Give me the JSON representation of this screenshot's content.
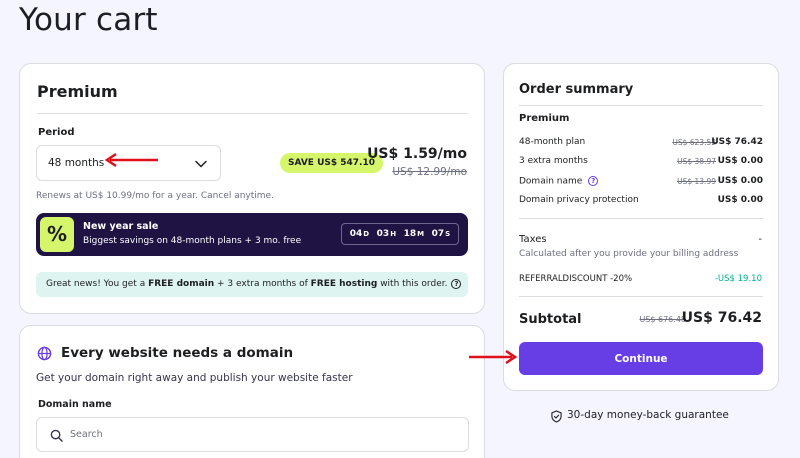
{
  "page": {
    "title": "Your cart"
  },
  "plan": {
    "name": "Premium",
    "period_label": "Period",
    "period_value": "48 months",
    "save_badge": "SAVE US$ 547.10",
    "price": "US$ 1.59/mo",
    "old_price": "US$ 12.99/mo",
    "renews_note": "Renews at US$ 10.99/mo for a year. Cancel anytime.",
    "promo": {
      "icon": "%",
      "title": "New year sale",
      "subtitle": "Biggest savings on 48-month plans + 3 mo. free",
      "countdown": [
        {
          "value": "04",
          "unit": "D"
        },
        {
          "value": "03",
          "unit": "H"
        },
        {
          "value": "18",
          "unit": "M"
        },
        {
          "value": "07",
          "unit": "S"
        }
      ]
    },
    "news": {
      "part1": "Great news! You get a ",
      "bold1": "FREE domain",
      "part2": " + 3 extra months of ",
      "bold2": "FREE hosting",
      "part3": " with this order."
    }
  },
  "domain": {
    "title": "Every website needs a domain",
    "subtitle": "Get your domain right away and publish your website faster",
    "field_label": "Domain name",
    "search_placeholder": "Search"
  },
  "summary": {
    "title": "Order summary",
    "plan": "Premium",
    "rows": [
      {
        "label": "48-month plan",
        "old": "US$ 623.52",
        "value": "US$ 76.42"
      },
      {
        "label": "3 extra months",
        "old": "US$ 38.97",
        "value": "US$ 0.00"
      },
      {
        "label": "Domain name",
        "old": "US$ 13.99",
        "value": "US$ 0.00"
      },
      {
        "label": "Domain privacy protection",
        "old": "",
        "value": "US$ 0.00"
      }
    ],
    "taxes_label": "Taxes",
    "taxes_value": "-",
    "taxes_note": "Calculated after you provide your billing address",
    "discount_label": "REFERRALDISCOUNT -20%",
    "discount_value": "-US$ 19.10",
    "subtotal_label": "Subtotal",
    "subtotal_old": "US$ 676.48",
    "subtotal_value": "US$ 76.42",
    "continue_label": "Continue"
  },
  "guarantee": "30-day money-back guarantee",
  "colors": {
    "accent": "#673de6",
    "promo_bg": "#1f1343",
    "badge": "#d5f56b",
    "news_bg": "#def4f0",
    "discount": "#00b090",
    "annotation_arrow": "#e0101a"
  },
  "icons": [
    "chevron-down-icon",
    "percent-icon",
    "help-circle-icon",
    "globe-icon",
    "search-icon",
    "info-icon",
    "shield-check-icon",
    "red-arrow-annotation"
  ]
}
